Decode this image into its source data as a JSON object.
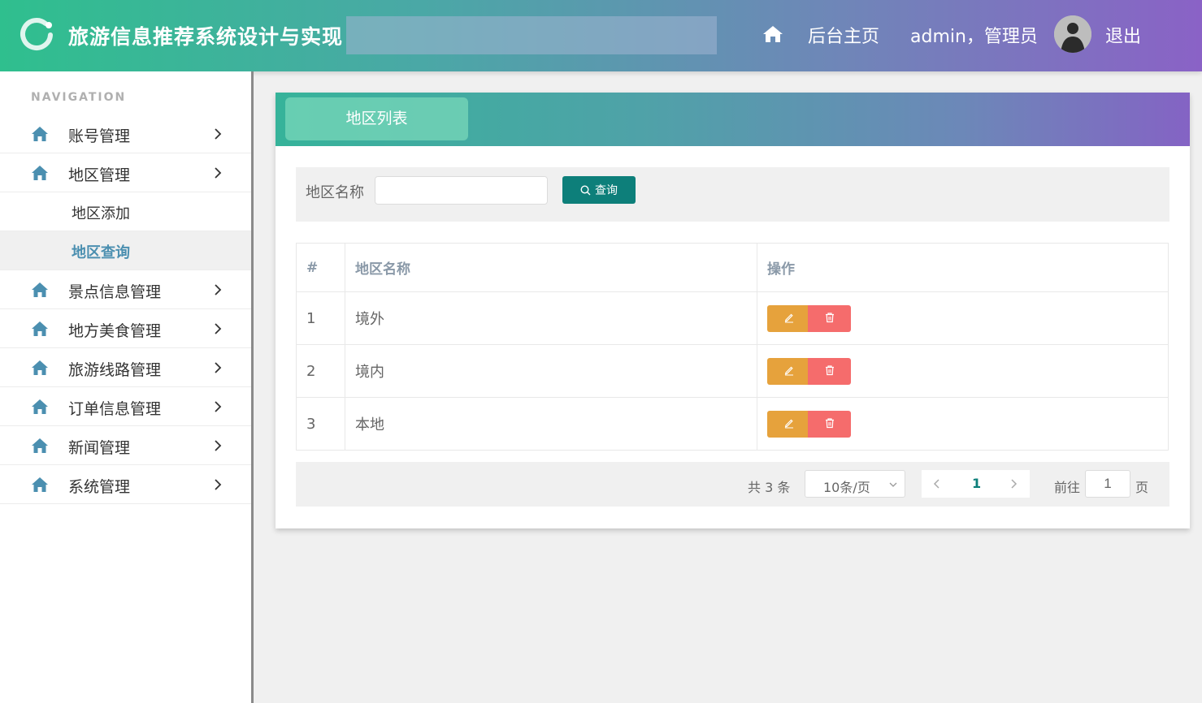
{
  "header": {
    "app_title": "旅游信息推荐系统设计与实现",
    "home_label": "后台主页",
    "user_label": "admin，管理员",
    "logout_label": "退出"
  },
  "sidebar": {
    "caption": "NAVIGATION",
    "items": [
      {
        "label": "账号管理"
      },
      {
        "label": "地区管理"
      },
      {
        "label": "景点信息管理"
      },
      {
        "label": "地方美食管理"
      },
      {
        "label": "旅游线路管理"
      },
      {
        "label": "订单信息管理"
      },
      {
        "label": "新闻管理"
      },
      {
        "label": "系统管理"
      }
    ],
    "sub_items": [
      {
        "label": "地区添加"
      },
      {
        "label": "地区查询",
        "active": true
      }
    ]
  },
  "card": {
    "tab_label": "地区列表",
    "search": {
      "label": "地区名称",
      "value": "",
      "placeholder": "",
      "button_label": "查询"
    },
    "table": {
      "headers": [
        "#",
        "地区名称",
        "操作"
      ],
      "rows": [
        {
          "idx": "1",
          "name": "境外"
        },
        {
          "idx": "2",
          "name": "境内"
        },
        {
          "idx": "3",
          "name": "本地"
        }
      ]
    },
    "pager": {
      "total_text": "共 3 条",
      "page_size": "10条/页",
      "current_page": "1",
      "goto_label": "前往",
      "goto_value": "1",
      "page_unit": "页"
    }
  },
  "colors": {
    "primary": "#0d7f7a",
    "edit": "#e6a23c",
    "delete": "#f56c6c",
    "active_nav": "#4b8fb0"
  }
}
